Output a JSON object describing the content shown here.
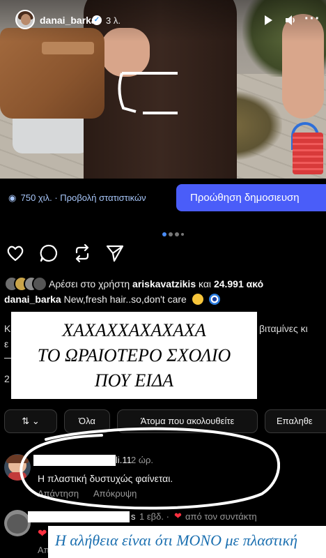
{
  "story": {
    "username": "danai_barka",
    "verified_icon": "verified-check-icon",
    "time": "3 λ."
  },
  "insights": {
    "views": "750 χιλ. · Προβολή στατιστικών",
    "promote_button": "Προώθηση δημοσιευση"
  },
  "carousel": {
    "total": 4,
    "active_index": 0
  },
  "actions": {
    "icons": [
      "heart-icon",
      "comment-icon",
      "repost-icon",
      "share-icon"
    ]
  },
  "likes": {
    "prefix": "Αρέσει στο χρήστη",
    "user": "ariskavatzikis",
    "middle": "και",
    "count": "24.991 ακό"
  },
  "caption": {
    "username": "danai_barka",
    "text": "New,fresh hair..so,don't care"
  },
  "hidden_lines": {
    "line1_left": "Κ",
    "line1_right": "βιταμίνες κι",
    "line2_left": "ε",
    "line3_left": "2"
  },
  "overlay1": {
    "line1": "ΧΑΧΑΧΧΑΧΑΧΑΧΑ",
    "line2": "ΤΟ ΩΡΑΙΟΤΕΡΟ ΣΧΟΛΙΟ",
    "line3": "ΠΟΥ ΕΙΔΑ"
  },
  "filters": {
    "sort_icon": "sort-arrows-icon",
    "all": "Όλα",
    "following": "Άτομα που ακολουθείτε",
    "verified": "Επαληθε"
  },
  "comment1": {
    "handle_tail": "li.11",
    "time": "2 ώρ.",
    "text": "Η πλαστική δυστυχώς φαίνεται.",
    "reply": "Απάντηση",
    "hide": "Απόκρυψη"
  },
  "comment2": {
    "handle_tail": "s",
    "time": "1 εβδ. ·",
    "liked_by_author": "από τον συντάκτη",
    "reply_partial": "Απ"
  },
  "overlay2": {
    "text": "Η αλήθεια είναι ότι ΜΟΝΟ με πλαστική"
  },
  "colors": {
    "background": "#000000",
    "promote": "#4a5df9",
    "stats_link": "#a8c7fa",
    "dot_active": "#4a8df9",
    "overlay_text_blue": "#1a6fb0",
    "heart_red": "#ff3040"
  }
}
